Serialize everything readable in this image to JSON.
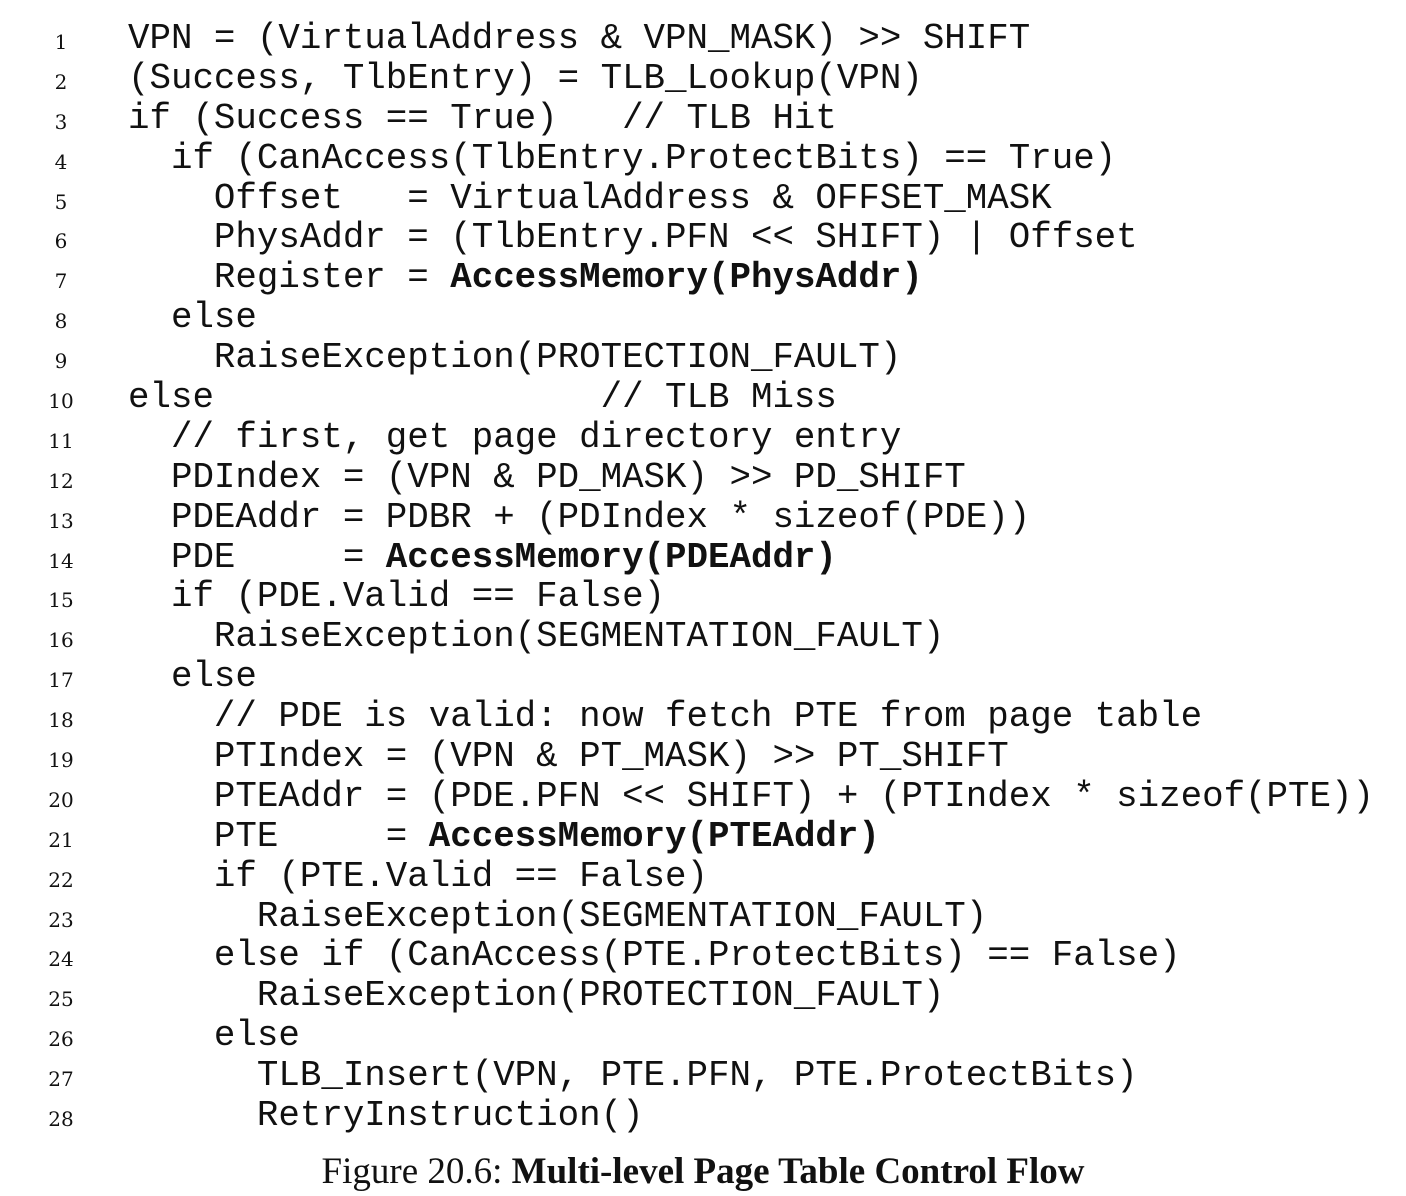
{
  "listing": {
    "lines": [
      {
        "num": "1",
        "segs": [
          {
            "t": "VPN = (VirtualAddress & VPN_MASK) >> SHIFT",
            "b": false
          }
        ]
      },
      {
        "num": "2",
        "segs": [
          {
            "t": "(Success, TlbEntry) = TLB_Lookup(VPN)",
            "b": false
          }
        ]
      },
      {
        "num": "3",
        "segs": [
          {
            "t": "if (Success == True)   // TLB Hit",
            "b": false
          }
        ]
      },
      {
        "num": "4",
        "segs": [
          {
            "t": "  if (CanAccess(TlbEntry.ProtectBits) == True)",
            "b": false
          }
        ]
      },
      {
        "num": "5",
        "segs": [
          {
            "t": "    Offset   = VirtualAddress & OFFSET_MASK",
            "b": false
          }
        ]
      },
      {
        "num": "6",
        "segs": [
          {
            "t": "    PhysAddr = (TlbEntry.PFN << SHIFT) | Offset",
            "b": false
          }
        ]
      },
      {
        "num": "7",
        "segs": [
          {
            "t": "    Register = ",
            "b": false
          },
          {
            "t": "AccessMemory(PhysAddr)",
            "b": true
          }
        ]
      },
      {
        "num": "8",
        "segs": [
          {
            "t": "  else",
            "b": false
          }
        ]
      },
      {
        "num": "9",
        "segs": [
          {
            "t": "    RaiseException(PROTECTION_FAULT)",
            "b": false
          }
        ]
      },
      {
        "num": "10",
        "segs": [
          {
            "t": "else                  // TLB Miss",
            "b": false
          }
        ]
      },
      {
        "num": "11",
        "segs": [
          {
            "t": "  // first, get page directory entry",
            "b": false
          }
        ]
      },
      {
        "num": "12",
        "segs": [
          {
            "t": "  PDIndex = (VPN & PD_MASK) >> PD_SHIFT",
            "b": false
          }
        ]
      },
      {
        "num": "13",
        "segs": [
          {
            "t": "  PDEAddr = PDBR + (PDIndex * sizeof(PDE))",
            "b": false
          }
        ]
      },
      {
        "num": "14",
        "segs": [
          {
            "t": "  PDE     = ",
            "b": false
          },
          {
            "t": "AccessMemory(PDEAddr)",
            "b": true
          }
        ]
      },
      {
        "num": "15",
        "segs": [
          {
            "t": "  if (PDE.Valid == False)",
            "b": false
          }
        ]
      },
      {
        "num": "16",
        "segs": [
          {
            "t": "    RaiseException(SEGMENTATION_FAULT)",
            "b": false
          }
        ]
      },
      {
        "num": "17",
        "segs": [
          {
            "t": "  else",
            "b": false
          }
        ]
      },
      {
        "num": "18",
        "segs": [
          {
            "t": "    // PDE is valid: now fetch PTE from page table",
            "b": false
          }
        ]
      },
      {
        "num": "19",
        "segs": [
          {
            "t": "    PTIndex = (VPN & PT_MASK) >> PT_SHIFT",
            "b": false
          }
        ]
      },
      {
        "num": "20",
        "segs": [
          {
            "t": "    PTEAddr = (PDE.PFN << SHIFT) + (PTIndex * sizeof(PTE))",
            "b": false
          }
        ]
      },
      {
        "num": "21",
        "segs": [
          {
            "t": "    PTE     = ",
            "b": false
          },
          {
            "t": "AccessMemory(PTEAddr)",
            "b": true
          }
        ]
      },
      {
        "num": "22",
        "segs": [
          {
            "t": "    if (PTE.Valid == False)",
            "b": false
          }
        ]
      },
      {
        "num": "23",
        "segs": [
          {
            "t": "      RaiseException(SEGMENTATION_FAULT)",
            "b": false
          }
        ]
      },
      {
        "num": "24",
        "segs": [
          {
            "t": "    else if (CanAccess(PTE.ProtectBits) == False)",
            "b": false
          }
        ]
      },
      {
        "num": "25",
        "segs": [
          {
            "t": "      RaiseException(PROTECTION_FAULT)",
            "b": false
          }
        ]
      },
      {
        "num": "26",
        "segs": [
          {
            "t": "    else",
            "b": false
          }
        ]
      },
      {
        "num": "27",
        "segs": [
          {
            "t": "      TLB_Insert(VPN, PTE.PFN, PTE.ProtectBits)",
            "b": false
          }
        ]
      },
      {
        "num": "28",
        "segs": [
          {
            "t": "      RetryInstruction()",
            "b": false
          }
        ]
      }
    ]
  },
  "caption": {
    "label": "Figure 20.6: ",
    "title": "Multi-level Page Table Control Flow"
  }
}
